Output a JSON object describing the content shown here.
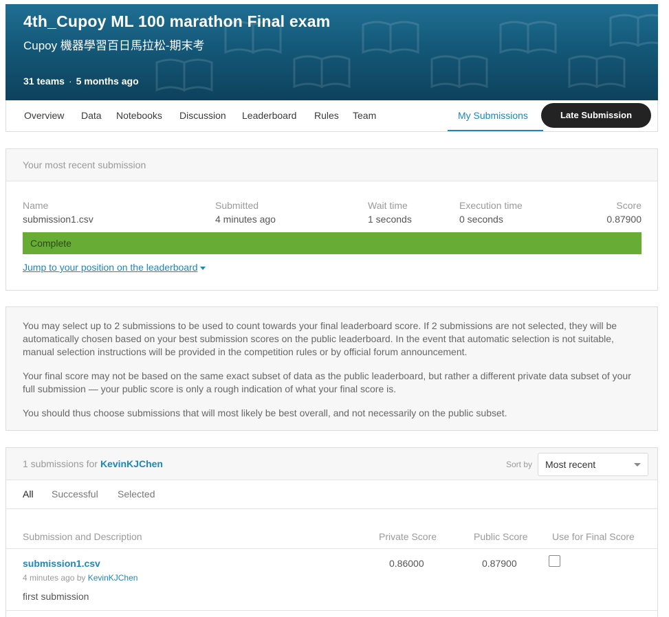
{
  "hero": {
    "title": "4th_Cupoy ML 100 marathon Final exam",
    "subtitle": "Cupoy 機器學習百日馬拉松-期末考",
    "teams": "31 teams",
    "separator": "·",
    "age": "5 months ago"
  },
  "tabs": {
    "overview": "Overview",
    "data": "Data",
    "notebooks": "Notebooks",
    "discussion": "Discussion",
    "leaderboard": "Leaderboard",
    "rules": "Rules",
    "team": "Team",
    "my_submissions": "My Submissions",
    "late_submission": "Late Submission"
  },
  "recent": {
    "header": "Your most recent submission",
    "columns": {
      "name": "Name",
      "submitted": "Submitted",
      "wait": "Wait time",
      "execution": "Execution time",
      "score": "Score"
    },
    "values": {
      "name": "submission1.csv",
      "submitted": "4 minutes ago",
      "wait": "1 seconds",
      "execution": "0 seconds",
      "score": "0.87900"
    },
    "status": "Complete",
    "jump_link": "Jump to your position on the leaderboard"
  },
  "info": {
    "p1": "You may select up to 2 submissions to be used to count towards your final leaderboard score. If 2 submissions are not selected, they will be automatically chosen based on your best submission scores on the public leaderboard. In the event that automatic selection is not suitable, manual selection instructions will be provided in the competition rules or by official forum announcement.",
    "p2": "Your final score may not be based on the same exact subset of data as the public leaderboard, but rather a different private data subset of your full submission — your public score is only a rough indication of what your final score is.",
    "p3": "You should thus choose submissions that will most likely be best overall, and not necessarily on the public subset."
  },
  "submissions": {
    "count_label": "1 submissions for",
    "user": "KevinKJChen",
    "sort_label": "Sort by",
    "sort_value": "Most recent",
    "filters": {
      "all": "All",
      "successful": "Successful",
      "selected": "Selected"
    },
    "columns": {
      "description": "Submission and Description",
      "private": "Private Score",
      "public": "Public Score",
      "final": "Use for Final Score"
    },
    "rows": [
      {
        "file": "submission1.csv",
        "when": "4 minutes ago by",
        "by": "KevinKJChen",
        "description": "first submission",
        "private": "0.86000",
        "public": "0.87900",
        "selected": false
      }
    ]
  },
  "colors": {
    "accent": "#1f86b8",
    "complete": "#66ac35",
    "button_dark": "#232323"
  }
}
